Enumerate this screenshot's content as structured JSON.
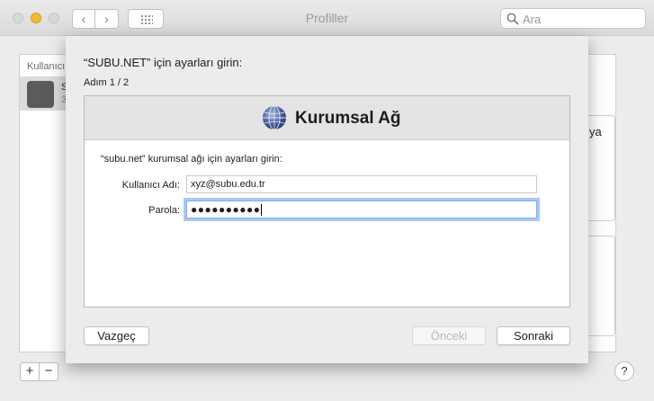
{
  "window": {
    "title": "Profiller",
    "search_placeholder": "Ara"
  },
  "background": {
    "list_header": "Kullanıcı",
    "row_initial": "S",
    "row_sub": "3",
    "side_text": "ya",
    "plus_label": "+",
    "minus_label": "−",
    "help_label": "?"
  },
  "sheet": {
    "title": "“SUBU.NET” için ayarları girin:",
    "step": "Adım 1 / 2",
    "panel_title": "Kurumsal Ağ",
    "instruction": "“subu.net” kurumsal ağı için ayarları girin:",
    "username_label": "Kullanıcı Adı:",
    "username_value": "xyz@subu.edu.tr",
    "password_label": "Parola:",
    "password_value": "●●●●●●●●●●",
    "buttons": {
      "cancel": "Vazgeç",
      "previous": "Önceki",
      "next": "Sonraki"
    }
  },
  "icons": {
    "globe": "network-globe-icon",
    "gear": "gear-icon",
    "search": "search-icon"
  },
  "colors": {
    "focus_ring": "#7eaef0",
    "minimize": "#f5b731"
  }
}
